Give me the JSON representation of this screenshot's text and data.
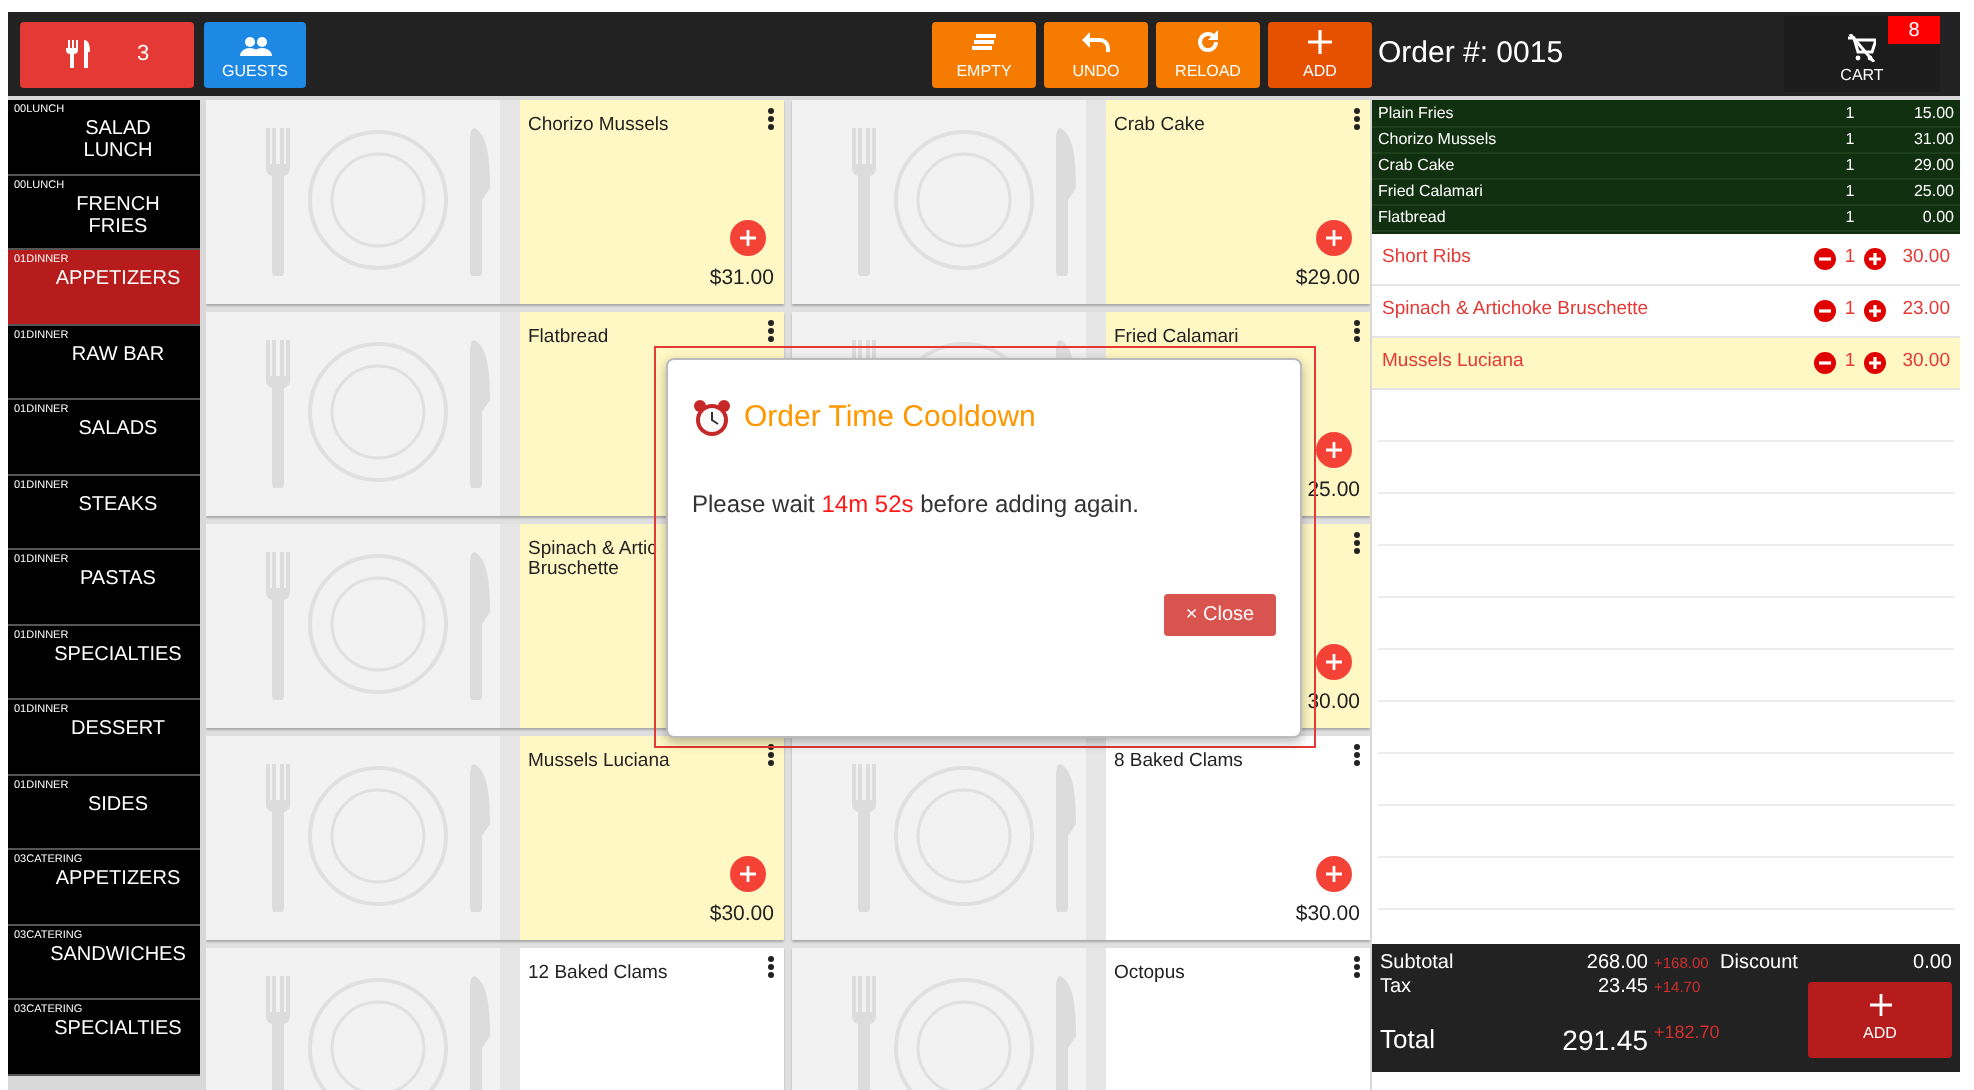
{
  "toolbar": {
    "table_count": "3",
    "guests_label": "GUESTS",
    "actions": [
      {
        "kind": "empty",
        "label": "EMPTY"
      },
      {
        "kind": "undo",
        "label": "UNDO"
      },
      {
        "kind": "reload",
        "label": "RELOAD"
      },
      {
        "kind": "add",
        "label": "ADD"
      }
    ]
  },
  "order": {
    "title": "Order #: 0015",
    "cart_label": "CART",
    "cart_count": "8"
  },
  "categories": [
    {
      "group": "00LUNCH",
      "label": "SALAD LUNCH",
      "selected": false
    },
    {
      "group": "00LUNCH",
      "label": "FRENCH FRIES",
      "selected": false
    },
    {
      "group": "01DINNER",
      "label": "APPETIZERS",
      "selected": true
    },
    {
      "group": "01DINNER",
      "label": "RAW BAR",
      "selected": false
    },
    {
      "group": "01DINNER",
      "label": "SALADS",
      "selected": false
    },
    {
      "group": "01DINNER",
      "label": "STEAKS",
      "selected": false
    },
    {
      "group": "01DINNER",
      "label": "PASTAS",
      "selected": false
    },
    {
      "group": "01DINNER",
      "label": "SPECIALTIES",
      "selected": false
    },
    {
      "group": "01DINNER",
      "label": "DESSERT",
      "selected": false
    },
    {
      "group": "01DINNER",
      "label": "SIDES",
      "selected": false
    },
    {
      "group": "03CATERING",
      "label": "APPETIZERS",
      "selected": false
    },
    {
      "group": "03CATERING",
      "label": "SANDWICHES",
      "selected": false
    },
    {
      "group": "03CATERING",
      "label": "SPECIALTIES",
      "selected": false
    }
  ],
  "products": [
    {
      "name": "Chorizo Mussels",
      "price": "$31.00",
      "in_order": true
    },
    {
      "name": "Crab Cake",
      "price": "$29.00",
      "in_order": true
    },
    {
      "name": "Flatbread",
      "in_order": true
    },
    {
      "name": "Fried Calamari",
      "price": "25.00",
      "in_order": true
    },
    {
      "name": "Spinach & Artic\nBruschette",
      "in_order": true
    },
    {
      "price": "30.00",
      "in_order": true
    },
    {
      "name": "Mussels Luciana",
      "price": "$30.00",
      "in_order": true
    },
    {
      "name": "8 Baked Clams",
      "price": "$30.00",
      "in_order": false
    },
    {
      "name": "12 Baked Clams",
      "in_order": false
    },
    {
      "name": "Octopus",
      "in_order": false
    }
  ],
  "sent_items": [
    {
      "name": "Plain Fries",
      "qty": "1",
      "price": "15.00"
    },
    {
      "name": "Chorizo Mussels",
      "qty": "1",
      "price": "31.00"
    },
    {
      "name": "Crab Cake",
      "qty": "1",
      "price": "29.00"
    },
    {
      "name": "Fried Calamari",
      "qty": "1",
      "price": "25.00"
    },
    {
      "name": "Flatbread",
      "qty": "1",
      "price": "0.00"
    }
  ],
  "new_items": [
    {
      "name": "Short Ribs",
      "qty": "1",
      "price": "30.00",
      "selected": false
    },
    {
      "name": "Spinach & Artichoke Bruschette",
      "qty": "1",
      "price": "23.00",
      "selected": false
    },
    {
      "name": "Mussels Luciana",
      "qty": "1",
      "price": "30.00",
      "selected": true
    }
  ],
  "totals": {
    "subtotal_label": "Subtotal",
    "subtotal": "268.00",
    "subtotal_change": "+168.00",
    "discount_label": "Discount",
    "discount": "0.00",
    "tax_label": "Tax",
    "tax": "23.45",
    "tax_change": "+14.70",
    "total_label": "Total",
    "total": "291.45",
    "total_change": "+182.70",
    "add_label": "ADD"
  },
  "dialog": {
    "title": "Order Time Cooldown",
    "message_start": "Please wait",
    "countdown": "14m 52s",
    "message_end": "before adding again.",
    "close_label": "× Close"
  }
}
